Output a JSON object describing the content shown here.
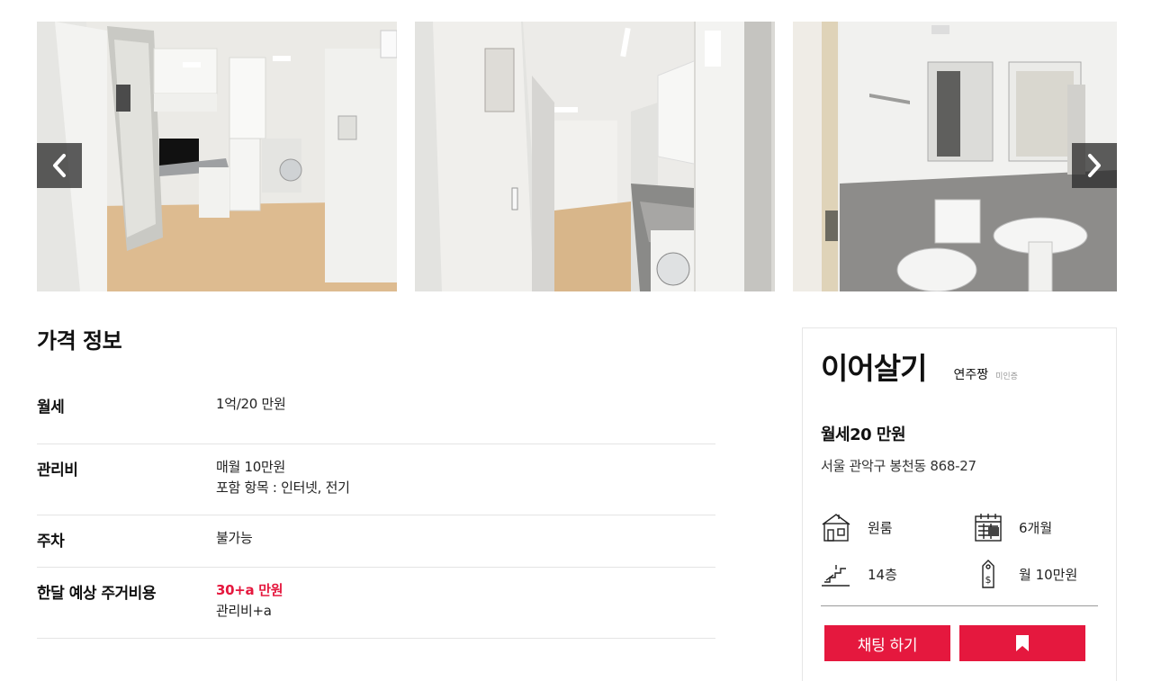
{
  "gallery": {
    "prev_icon": "chevron-left-icon",
    "next_icon": "chevron-right-icon"
  },
  "price_info": {
    "title": "가격 정보",
    "rows": [
      {
        "label": "월세",
        "value": "1억/20 만원"
      },
      {
        "label": "관리비",
        "value": "매월 10만원",
        "sub": "포함 항목 : 인터넷, 전기"
      },
      {
        "label": "주차",
        "value": "불가능"
      },
      {
        "label": "한달 예상 주거비용",
        "value": "30+a 만원",
        "sub": "관리비+a"
      }
    ],
    "accent_color": "#e5183e"
  },
  "card": {
    "title": "이어살기",
    "owner": "연주짱",
    "owner_status": "미인증",
    "price": "월세20 만원",
    "address": "서울 관악구 봉천동 868-27",
    "features": [
      {
        "icon": "house-icon",
        "label": "원룸"
      },
      {
        "icon": "calendar-icon",
        "label": "6개월"
      },
      {
        "icon": "stairs-icon",
        "label": "14층"
      },
      {
        "icon": "price-tag-icon",
        "label": "월 10만원"
      }
    ],
    "chat_button": "채팅 하기",
    "bookmark_icon": "bookmark-icon",
    "button_color": "#e5183e"
  }
}
